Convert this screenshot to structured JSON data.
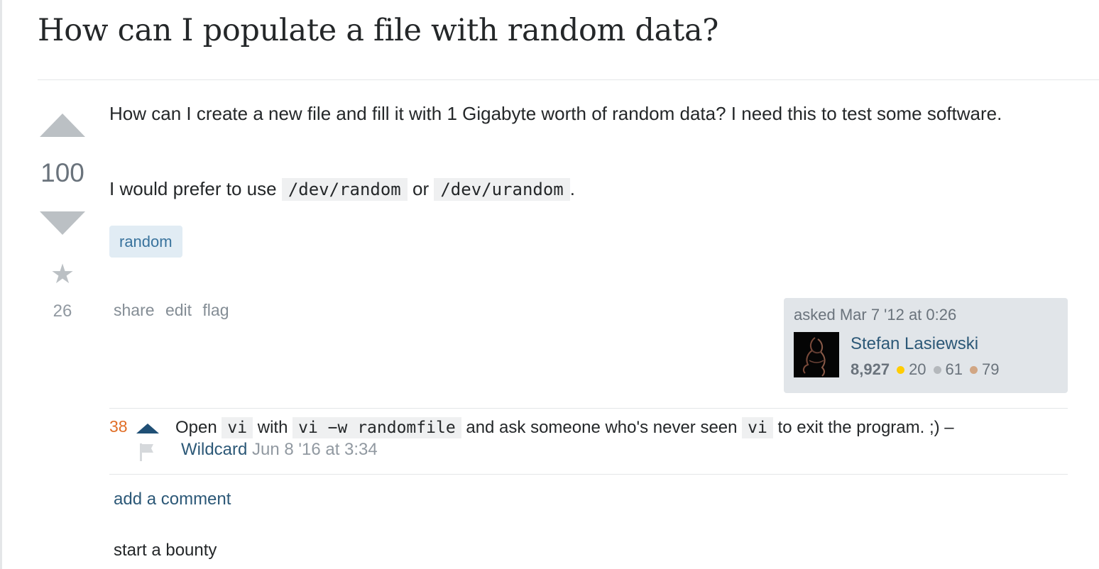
{
  "question": {
    "title": "How can I populate a file with random data?",
    "votes": "100",
    "favorites": "26",
    "body": {
      "p1": "How can I create a new file and fill it with 1 Gigabyte worth of random data? I need this to test some software.",
      "p2_prefix": "I would prefer to use ",
      "p2_code1": "/dev/random",
      "p2_mid": " or ",
      "p2_code2": "/dev/urandom",
      "p2_suffix": "."
    },
    "tags": [
      "random"
    ]
  },
  "post_menu": {
    "share": "share",
    "edit": "edit",
    "flag": "flag"
  },
  "owner": {
    "asked": "asked Mar 7 '12 at 0:26",
    "name": "Stefan Lasiewski",
    "reputation": "8,927",
    "gold": "20",
    "silver": "61",
    "bronze": "79"
  },
  "comment": {
    "score": "38",
    "t1": "Open ",
    "c1": "vi",
    "t2": " with ",
    "c2": "vi −w randomfile",
    "t3": " and ask someone who's never seen ",
    "c3": "vi",
    "t4": " to exit the program. ;) –",
    "user": "Wildcard",
    "date": "Jun 8 '16 at 3:34"
  },
  "actions": {
    "add_comment": "add a comment",
    "start_bounty": "start a bounty"
  },
  "colors": {
    "link": "#2c5877",
    "tag_bg": "#e1ecf4",
    "tag_text": "#39739d",
    "comment_score": "#e06e27",
    "code_bg": "#eff0f1",
    "owner_card_bg": "#e1e5e9"
  },
  "icons": {
    "vote_up": "up-arrow-icon",
    "vote_down": "down-arrow-icon",
    "favorite": "star-icon",
    "comment_upvote": "comment-upvote-icon",
    "comment_flag": "flag-icon"
  }
}
